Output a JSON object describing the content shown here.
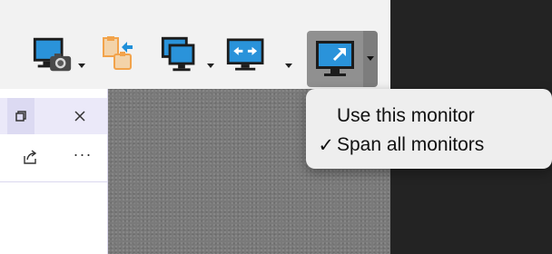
{
  "toolbar": {
    "buttons": [
      {
        "icon": "screenshot-monitor-icon",
        "has_dropdown": true
      },
      {
        "icon": "paste-to-clipboard-icon",
        "has_dropdown": false
      },
      {
        "icon": "multiple-monitors-icon",
        "has_dropdown": true
      },
      {
        "icon": "fit-to-window-icon",
        "has_dropdown": true
      },
      {
        "icon": "full-screen-monitor-icon",
        "has_dropdown": true,
        "active": true
      }
    ]
  },
  "app_window": {
    "restore_icon": "restore-window-icon",
    "close_icon": "close-icon",
    "share_icon": "share-icon",
    "more_label": "···"
  },
  "monitor_menu": {
    "items": [
      {
        "label": "Use this monitor",
        "checked": false,
        "check": ""
      },
      {
        "label": "Span all monitors",
        "checked": true,
        "check": "✓"
      }
    ]
  },
  "colors": {
    "monitor_blue": "#1f8fd9",
    "monitor_dark": "#1c1c1c",
    "accent_orange": "#f2a34b",
    "menu_bg": "#eeeeee"
  }
}
